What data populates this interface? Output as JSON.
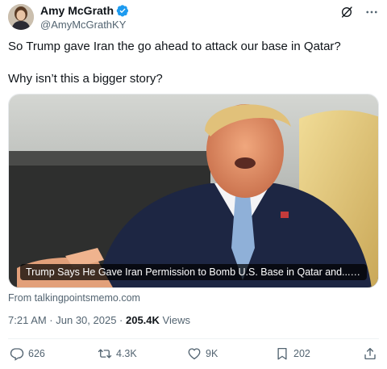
{
  "author": {
    "name": "Amy McGrath",
    "handle": "@AmyMcGrathKY",
    "verified": true,
    "verified_color": "#1d9bf0"
  },
  "tweet": {
    "line1": "So Trump gave Iran the go ahead to attack our base in Qatar?",
    "line2": "Why isn’t this a bigger story?"
  },
  "media": {
    "caption": "Trump Says He Gave Iran Permission to Bomb U.S. Base in Qatar and...Well, Mostly Cri..."
  },
  "source": {
    "label": "From talkingpointsmemo.com"
  },
  "meta": {
    "time_date": "7:21 AM · Jun 30, 2025 · ",
    "views_count": "205.4K",
    "views_label": " Views"
  },
  "actions": {
    "replies": "626",
    "reposts": "4.3K",
    "likes": "9K",
    "bookmarks": "202"
  },
  "icons": {
    "header": [
      "grok-icon",
      "more-icon"
    ],
    "actions": [
      "reply-icon",
      "repost-icon",
      "like-icon",
      "bookmark-icon",
      "share-icon"
    ]
  }
}
